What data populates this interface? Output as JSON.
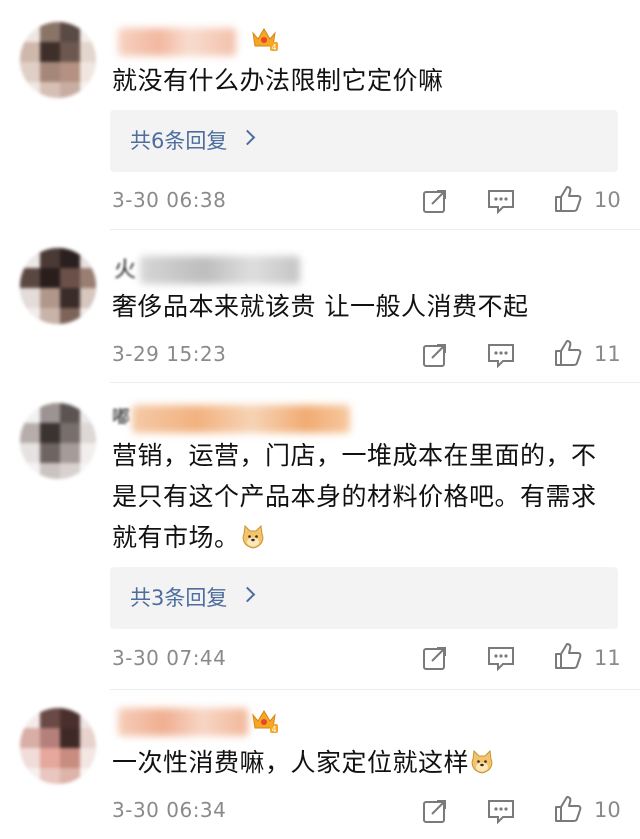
{
  "comments": [
    {
      "name_initial": "",
      "content": "就没有什么办法限制它定价嘛",
      "reply_label": "共6条回复",
      "time": "3-30 06:38",
      "likes": "10",
      "crown_level": "4"
    },
    {
      "name_initial": "火",
      "content": "奢侈品本来就该贵 让一般人消费不起",
      "time": "3-29 15:23",
      "likes": "11"
    },
    {
      "name_initial": "嘟",
      "content_lines": [
        "营销，运营，门店，一堆成本在里面的，不",
        "是只有这个产品本身的材料价格吧。有需求",
        "就有市场。"
      ],
      "reply_label": "共3条回复",
      "time": "3-30 07:44",
      "likes": "11",
      "emoji": "doge-face-icon"
    },
    {
      "name_initial": "",
      "content": "一次性消费嘛，人家定位就这样",
      "time": "3-30 06:34",
      "likes": "10",
      "crown_level": "4",
      "emoji": "doge-face-icon"
    }
  ],
  "colors": {
    "reply_link": "#4d6d9e",
    "meta_gray": "#8a8a8a",
    "reply_bg": "#f3f3f3",
    "crown": "#f5a623"
  }
}
